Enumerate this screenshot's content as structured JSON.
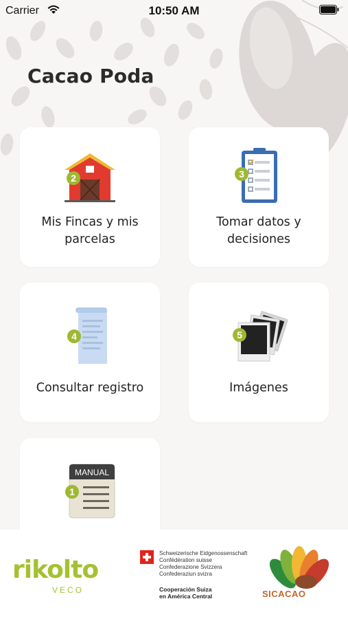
{
  "status_bar": {
    "carrier": "Carrier",
    "time": "10:50 AM"
  },
  "app": {
    "title": "Cacao Poda"
  },
  "menu": {
    "items": [
      {
        "label": "Mis Fincas y mis parcelas",
        "line1": "Mis Fincas y mis",
        "line2": "parcelas",
        "badge": "2",
        "icon": "barn-icon"
      },
      {
        "label": "Tomar datos y decisiones",
        "line1": "Tomar datos y",
        "line2": "decisiones",
        "badge": "3",
        "icon": "clipboard-checklist-icon"
      },
      {
        "label": "Consultar registro",
        "line1": "Consultar registro",
        "line2": "",
        "badge": "4",
        "icon": "document-scroll-icon"
      },
      {
        "label": "Imágenes",
        "line1": "Imágenes",
        "line2": "",
        "badge": "5",
        "icon": "photos-icon"
      },
      {
        "label": "MANUAL",
        "badge": "1",
        "icon": "manual-icon"
      }
    ]
  },
  "footer": {
    "rikolto": "rikolto",
    "veco": "VECO",
    "swiss_lines": [
      "Schweizerische Eidgenossenschaft",
      "Confédération suisse",
      "Confederazione Svizzera",
      "Confederaziun svizra"
    ],
    "swiss_coop": [
      "Cooperación Suiza",
      "en América Central"
    ],
    "sicacao": "SICACAO"
  },
  "colors": {
    "badge": "#9fb832",
    "title": "#2b2b2b",
    "rikolto_green": "#a4c131"
  }
}
